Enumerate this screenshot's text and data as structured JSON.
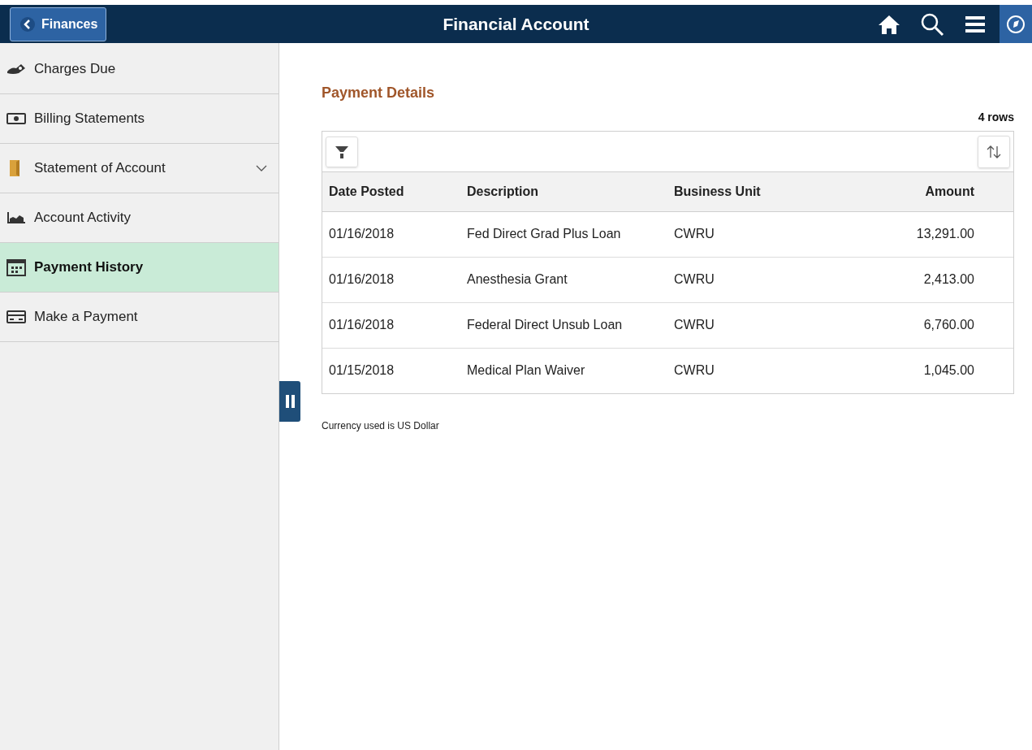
{
  "header": {
    "back_button": "Finances",
    "title": "Financial Account"
  },
  "sidebar": {
    "items": [
      {
        "label": "Charges Due",
        "selected": false
      },
      {
        "label": "Billing Statements",
        "selected": false
      },
      {
        "label": "Statement of Account",
        "selected": false,
        "expanded": false
      },
      {
        "label": "Account Activity",
        "selected": false
      },
      {
        "label": "Payment History",
        "selected": true
      },
      {
        "label": "Make a Payment",
        "selected": false
      }
    ]
  },
  "content": {
    "section_title": "Payment Details",
    "row_count": "4 rows",
    "table": {
      "columns": [
        "Date Posted",
        "Description",
        "Business Unit",
        "Amount"
      ],
      "rows": [
        [
          "01/16/2018",
          "Fed Direct Grad Plus Loan",
          "CWRU",
          "13,291.00"
        ],
        [
          "01/16/2018",
          "Anesthesia Grant",
          "CWRU",
          "2,413.00"
        ],
        [
          "01/16/2018",
          "Federal Direct Unsub Loan",
          "CWRU",
          "6,760.00"
        ],
        [
          "01/15/2018",
          "Medical Plan Waiver",
          "CWRU",
          "1,045.00"
        ]
      ]
    },
    "footnote": "Currency used is US Dollar"
  }
}
